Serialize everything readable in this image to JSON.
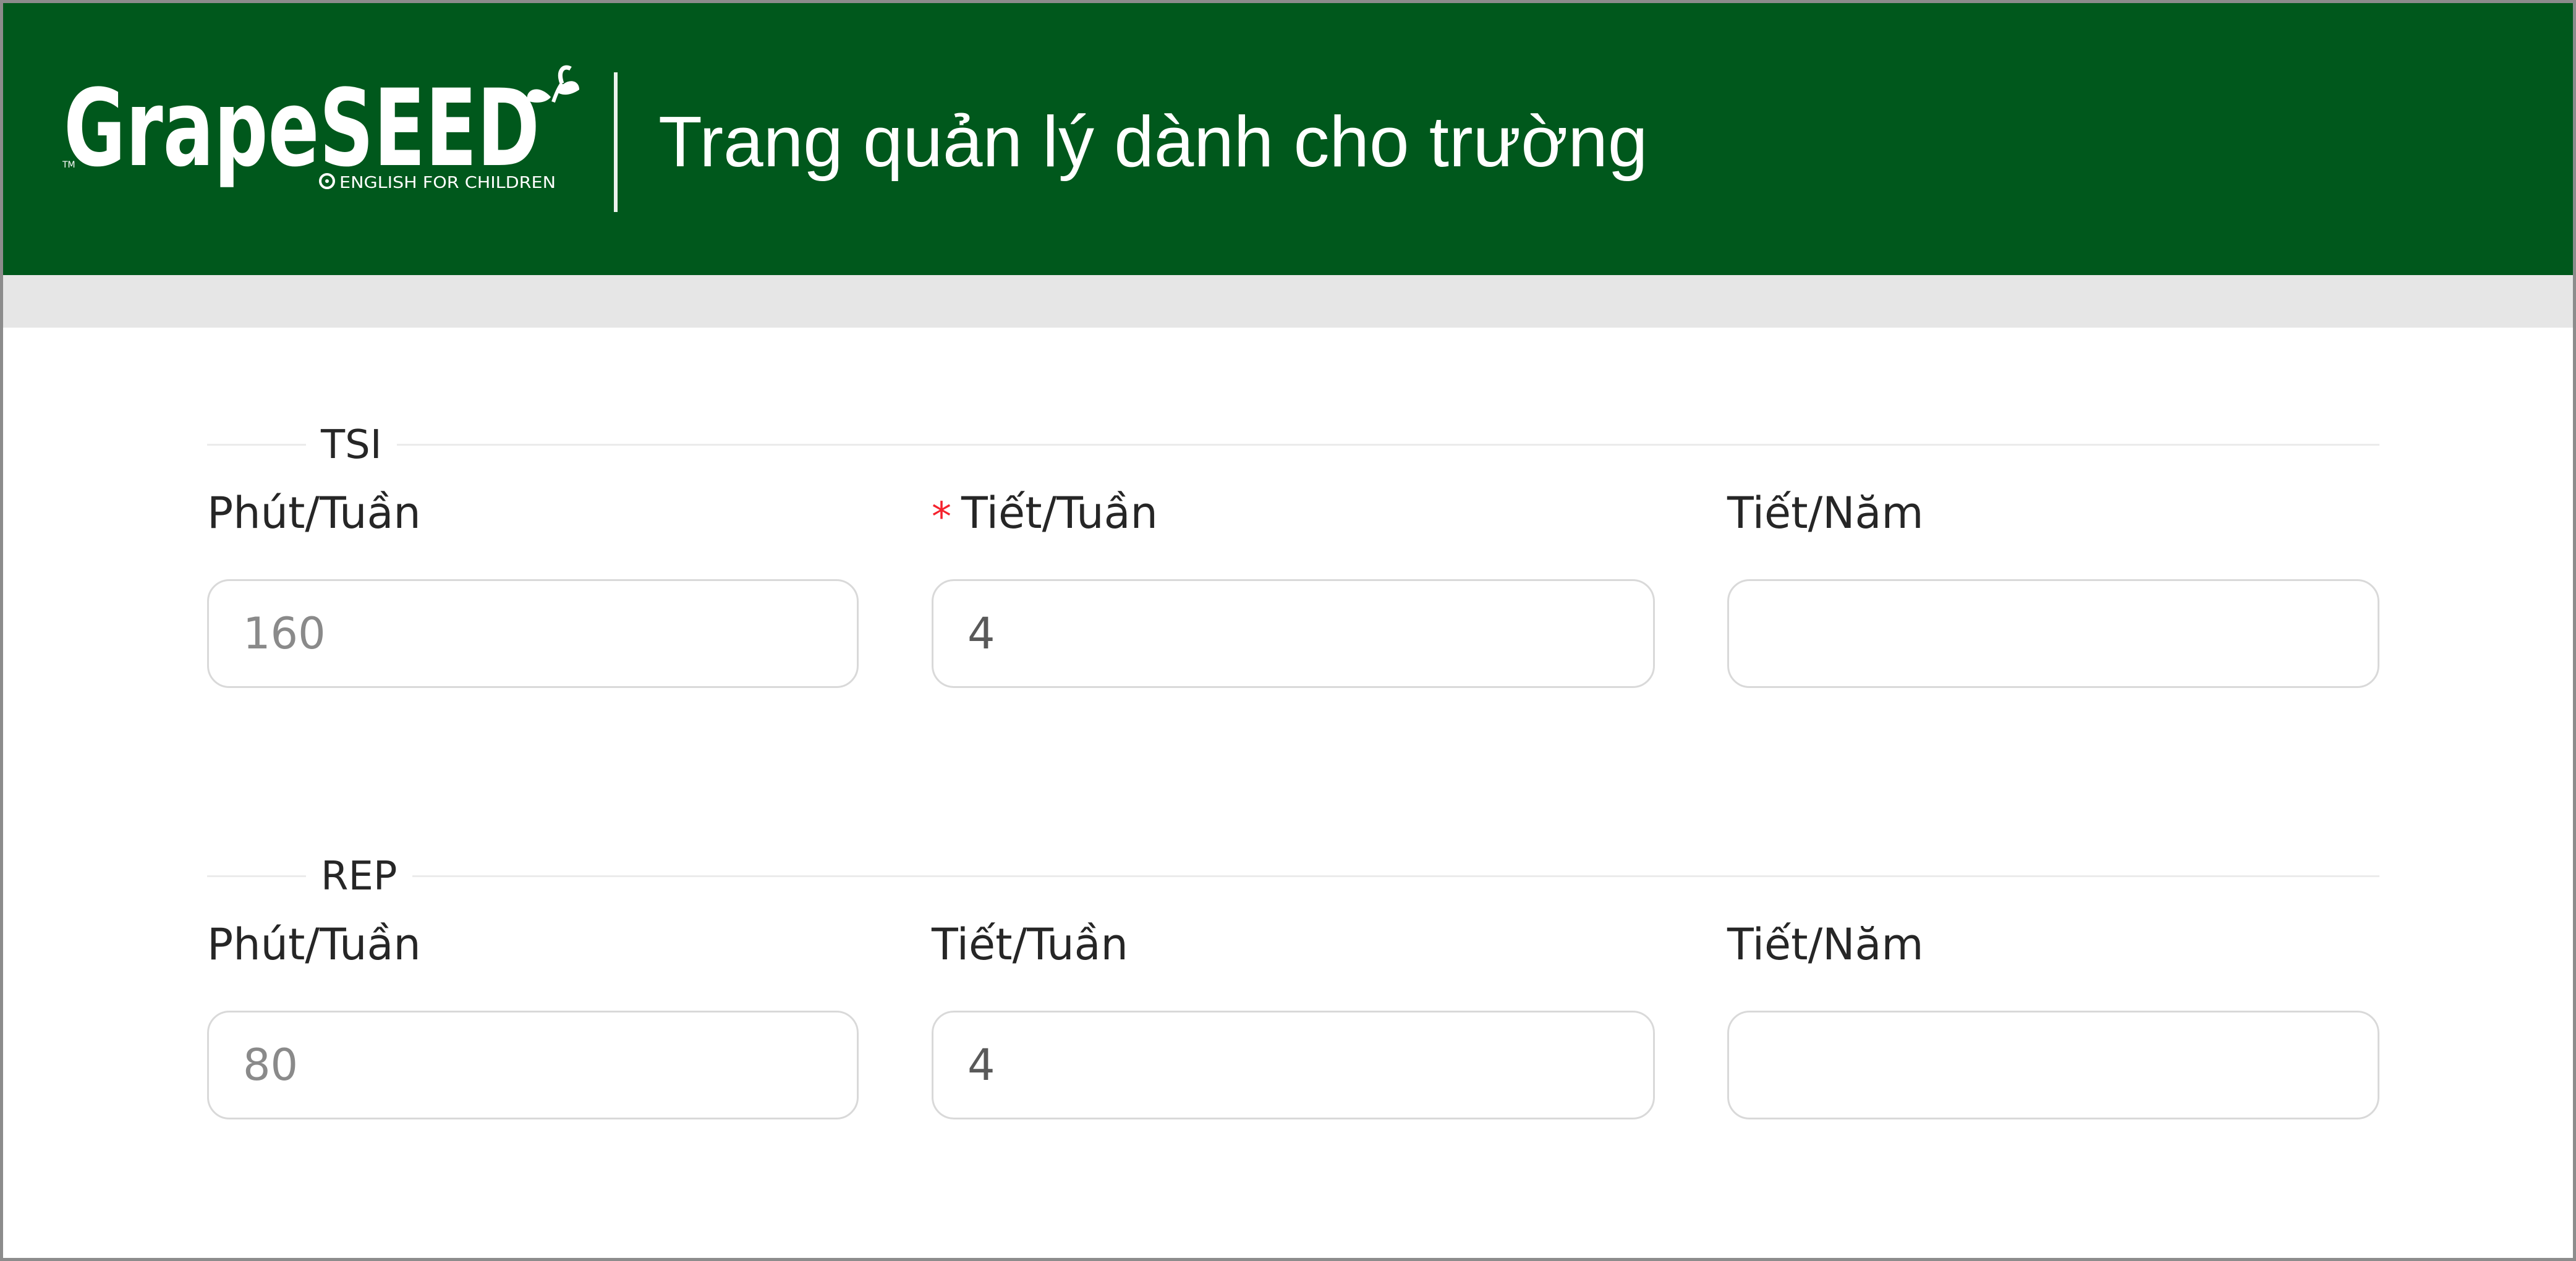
{
  "header": {
    "logo_text": "GrapeSEED",
    "logo_tagline": "ENGLISH FOR CHILDREN",
    "logo_tm": "TM",
    "title": "Trang quản lý dành cho trường"
  },
  "sections": [
    {
      "title": "TSI",
      "fields": [
        {
          "label": "Phút/Tuần",
          "value": "160",
          "required": false,
          "disabled": true
        },
        {
          "label": "Tiết/Tuần",
          "value": "4",
          "required": true,
          "disabled": false
        },
        {
          "label": "Tiết/Năm",
          "value": "",
          "required": false,
          "disabled": false
        }
      ]
    },
    {
      "title": "REP",
      "fields": [
        {
          "label": "Phút/Tuần",
          "value": "80",
          "required": false,
          "disabled": true
        },
        {
          "label": "Tiết/Tuần",
          "value": "4",
          "required": false,
          "disabled": false
        },
        {
          "label": "Tiết/Năm",
          "value": "",
          "required": false,
          "disabled": false
        }
      ]
    }
  ],
  "colors": {
    "header_bg": "#00581c",
    "required_mark": "#f5222d",
    "input_border": "#d9d9d9"
  }
}
